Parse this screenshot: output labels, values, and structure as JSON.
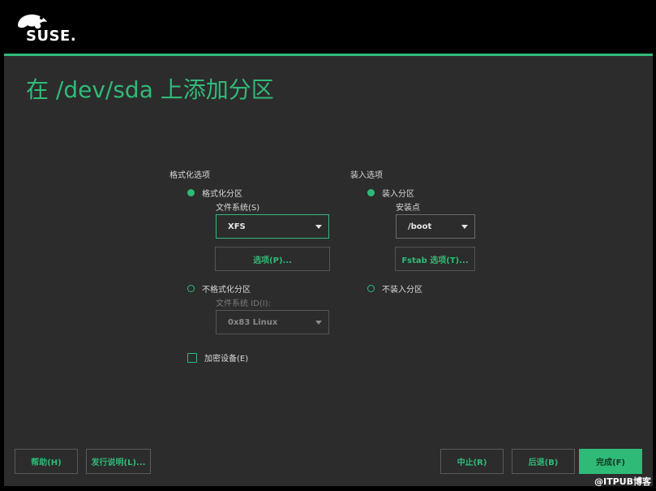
{
  "header": {
    "logo_text": "SUSE."
  },
  "page": {
    "title": "在 /dev/sda 上添加分区"
  },
  "format_options": {
    "section_label": "格式化选项",
    "format_radio": "格式化分区",
    "filesystem_label": "文件系统(S)",
    "filesystem_value": "XFS",
    "options_button": "选项(P)...",
    "no_format_radio": "不格式化分区",
    "filesystem_id_label": "文件系统 ID(I):",
    "filesystem_id_value": "0x83 Linux",
    "encrypt_checkbox": "加密设备(E)"
  },
  "mount_options": {
    "section_label": "装入选项",
    "mount_radio": "装入分区",
    "mount_point_label": "安装点",
    "mount_point_value": "/boot",
    "fstab_button": "Fstab 选项(T)...",
    "no_mount_radio": "不装入分区"
  },
  "footer": {
    "help": "帮助(H)",
    "release_notes": "发行说明(L)...",
    "abort": "中止(R)",
    "back": "后退(B)",
    "finish": "完成(F)"
  },
  "watermark": "@ITPUB博客",
  "colors": {
    "accent": "#30ba78",
    "panel": "#2c2c2c",
    "background": "#000000"
  }
}
